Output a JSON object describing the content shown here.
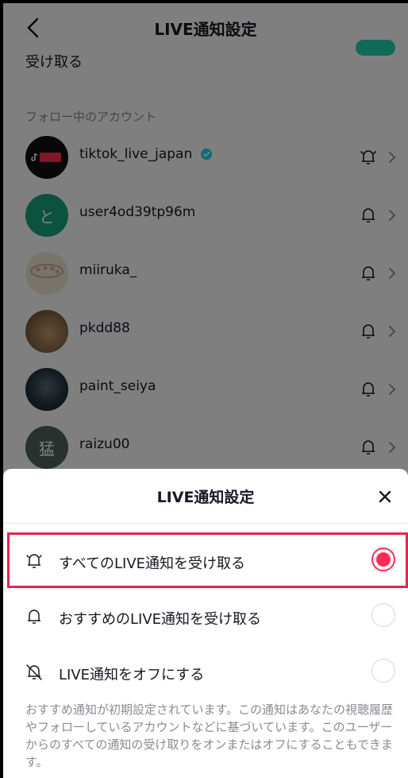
{
  "header": {
    "title": "LIVE通知設定"
  },
  "top_setting": {
    "label": "受け取る",
    "toggle_on": true
  },
  "section": {
    "title": "フォロー中のアカウント"
  },
  "accounts": [
    {
      "username": "tiktok_live_japan",
      "verified": true,
      "avatar_badge": "LIVE",
      "avatar_color": "#111111",
      "bell": "bell-all"
    },
    {
      "username": "user4od39tp96m",
      "verified": false,
      "avatar_text": "と",
      "avatar_color": "#1aa57c",
      "bell": "bell"
    },
    {
      "username": "miiruka_",
      "verified": false,
      "avatar_color": "#f1e7d6",
      "bell": "bell"
    },
    {
      "username": "pkdd88",
      "verified": false,
      "avatar_color": "#8a6a46",
      "bell": "bell"
    },
    {
      "username": "paint_seiya",
      "verified": false,
      "avatar_color": "#1a2630",
      "bell": "bell"
    },
    {
      "username": "raizu00",
      "verified": false,
      "avatar_text": "猛",
      "avatar_color": "#52625f",
      "bell": "bell"
    }
  ],
  "sheet": {
    "title": "LIVE通知設定",
    "options": [
      {
        "label": "すべてのLIVE通知を受け取る",
        "icon": "bell-ringing-icon",
        "selected": true
      },
      {
        "label": "おすすめのLIVE通知を受け取る",
        "icon": "bell-icon",
        "selected": false
      },
      {
        "label": "LIVE通知をオフにする",
        "icon": "bell-off-icon",
        "selected": false
      }
    ],
    "footnote": "おすすめ通知が初期設定されています。この通知はあなたの視聴履歴やフォローしているアカウントなどに基づいています。このユーザーからのすべての通知の受け取りをオンまたはオフにすることもできます。"
  },
  "colors": {
    "accent": "#fe2c55",
    "highlight": "#e8224f",
    "toggle": "#20d5b0",
    "verified": "#20d5ec",
    "text": "#161823",
    "secondary_text": "#8a8b91"
  }
}
